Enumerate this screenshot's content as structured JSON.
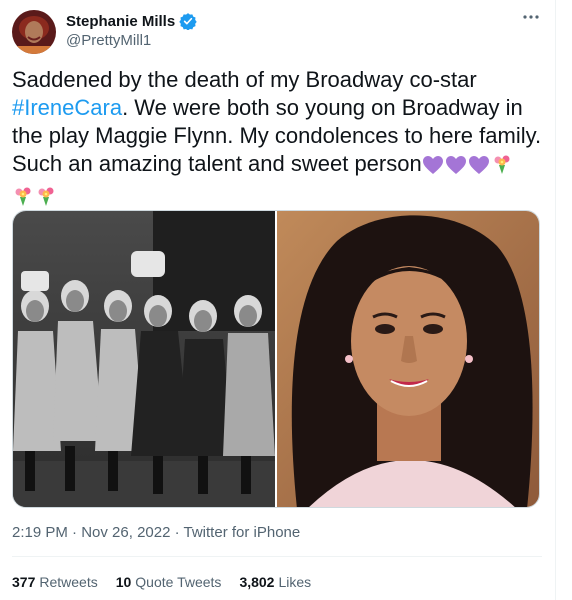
{
  "author": {
    "name": "Stephanie Mills",
    "handle": "@PrettyMill1",
    "verified_color": "#1d9bf0"
  },
  "tweet": {
    "line1": "Saddened by the death of my Broadway co-star",
    "hashtag": "#IreneCara",
    "line2_rest": ".  We were both so young on Broadway in",
    "line3": "the play Maggie Flynn.  My condolences to here family.",
    "line4": "Such an amazing talent and sweet person"
  },
  "meta": {
    "time": "2:19 PM",
    "sep1": " · ",
    "date": "Nov 26, 2022",
    "sep2": " · ",
    "source": "Twitter for iPhone"
  },
  "stats": {
    "retweets_count": "377",
    "retweets_label": "Retweets",
    "quotes_count": "10",
    "quotes_label": "Quote Tweets",
    "likes_count": "3,802",
    "likes_label": "Likes"
  },
  "colors": {
    "link": "#1d9bf0",
    "secondary_text": "#536471",
    "primary_text": "#0f1419"
  },
  "icons": [
    "verified-badge-icon",
    "more-icon",
    "purple-heart-icon",
    "bouquet-icon"
  ]
}
